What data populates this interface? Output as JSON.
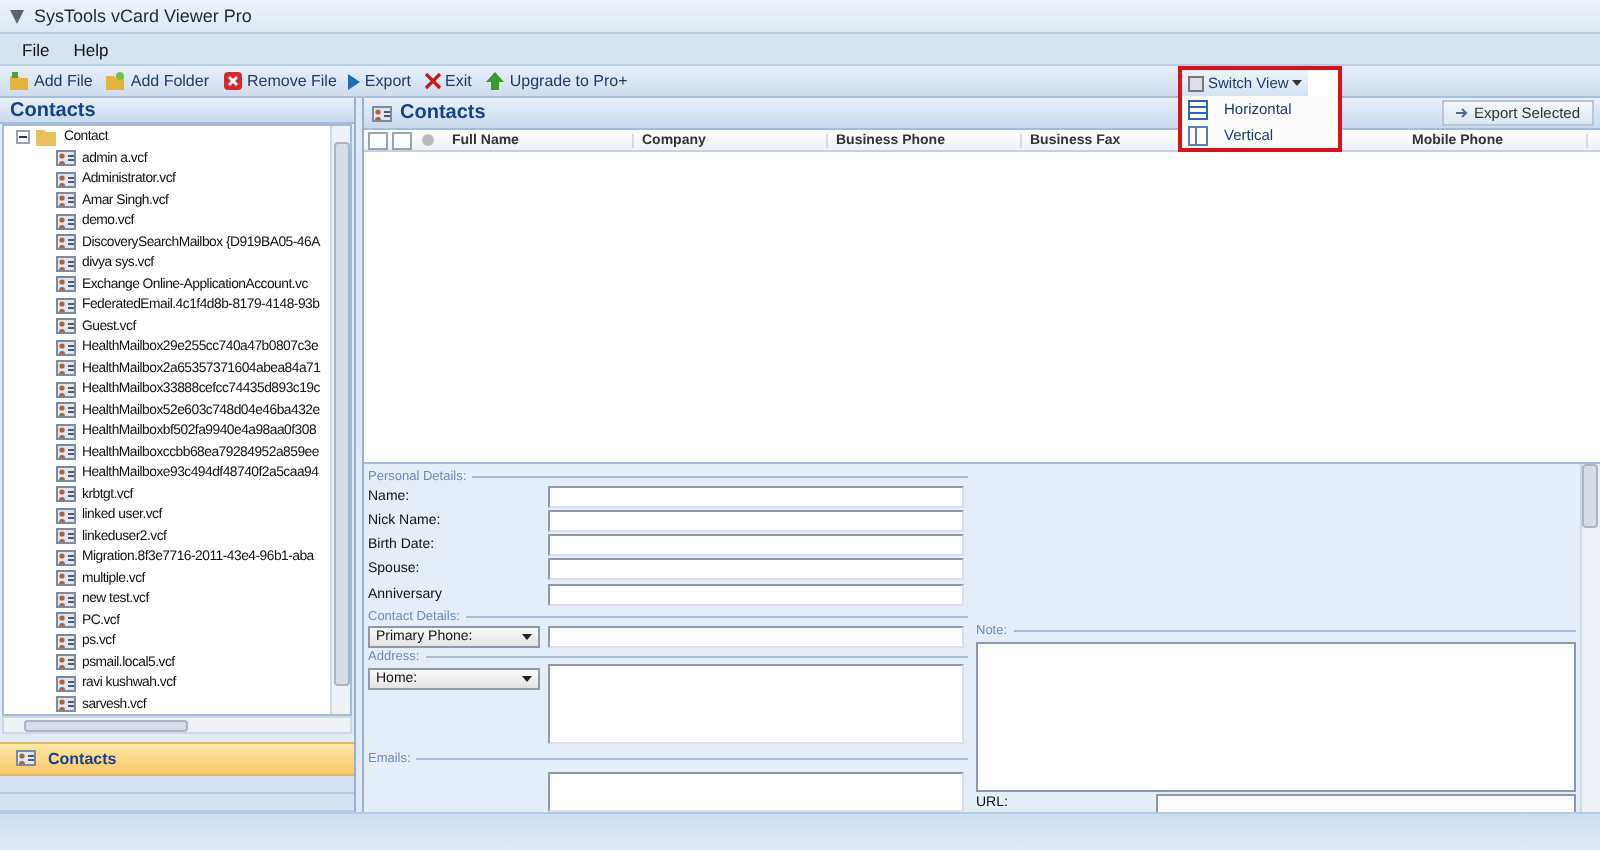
{
  "window": {
    "title": "SysTools vCard Viewer Pro"
  },
  "menu": [
    "File",
    "Help"
  ],
  "toolbar": [
    {
      "label": "Add File",
      "kind": "addfile"
    },
    {
      "label": "Add Folder",
      "kind": "addfolder"
    },
    {
      "label": "Remove File",
      "kind": "remove"
    },
    {
      "label": "Export",
      "kind": "export"
    },
    {
      "label": "Exit",
      "kind": "exit"
    },
    {
      "label": "Upgrade to Pro+",
      "kind": "upgrade"
    }
  ],
  "sidebar": {
    "title": "Contacts",
    "root": {
      "label": "Contact",
      "expanded": true,
      "children": [
        {
          "label": "admin a.vcf"
        },
        {
          "label": "Administrator.vcf"
        },
        {
          "label": "Amar Singh.vcf"
        },
        {
          "label": "demo.vcf"
        },
        {
          "label": "DiscoverySearchMailbox {D919BA05-46A"
        },
        {
          "label": "divya sys.vcf"
        },
        {
          "label": "Exchange Online-ApplicationAccount.vc"
        },
        {
          "label": "FederatedEmail.4c1f4d8b-8179-4148-93b"
        },
        {
          "label": "Guest.vcf"
        },
        {
          "label": "HealthMailbox29e255cc740a47b0807c3e"
        },
        {
          "label": "HealthMailbox2a65357371604abea84a71"
        },
        {
          "label": "HealthMailbox33888cefcc74435d893c19c"
        },
        {
          "label": "HealthMailbox52e603c748d04e46ba432e"
        },
        {
          "label": "HealthMailboxbf502fa9940e4a98aa0f308"
        },
        {
          "label": "HealthMailboxccbb68ea79284952a859ee"
        },
        {
          "label": "HealthMailboxe93c494df48740f2a5caa94"
        },
        {
          "label": "krbtgt.vcf"
        },
        {
          "label": "linked user.vcf"
        },
        {
          "label": "linkeduser2.vcf"
        },
        {
          "label": "Migration.8f3e7716-2011-43e4-96b1-aba"
        },
        {
          "label": "multiple.vcf"
        },
        {
          "label": "new test.vcf"
        },
        {
          "label": "PC.vcf"
        },
        {
          "label": "ps.vcf"
        },
        {
          "label": "psmail.local5.vcf"
        },
        {
          "label": "ravi kushwah.vcf"
        },
        {
          "label": "sarvesh.vcf"
        }
      ]
    },
    "nav": [
      {
        "label": "Contacts",
        "selected": true
      }
    ]
  },
  "main": {
    "title": "Contacts",
    "switch_view": {
      "label": "Switch View",
      "options": [
        {
          "label": "Horizontal",
          "kind": "horizontal"
        },
        {
          "label": "Vertical",
          "kind": "vertical"
        }
      ]
    },
    "export_button": "Export Selected",
    "select_all": {
      "checked": false
    },
    "columns": [
      "Full Name",
      "Company",
      "Business Phone",
      "Business Fax",
      "Mobile Phone"
    ]
  },
  "details": {
    "personal_label": "Personal Details:",
    "fields": [
      "Name:",
      "Nick Name:",
      "Birth Date:",
      "Spouse:",
      "Anniversary"
    ],
    "contact_label": "Contact Details:",
    "phone_select": "Primary Phone:",
    "address_label": "Address:",
    "address_select": "Home:",
    "emails_label": "Emails:",
    "note_label": "Note:",
    "url_label": "URL:"
  }
}
